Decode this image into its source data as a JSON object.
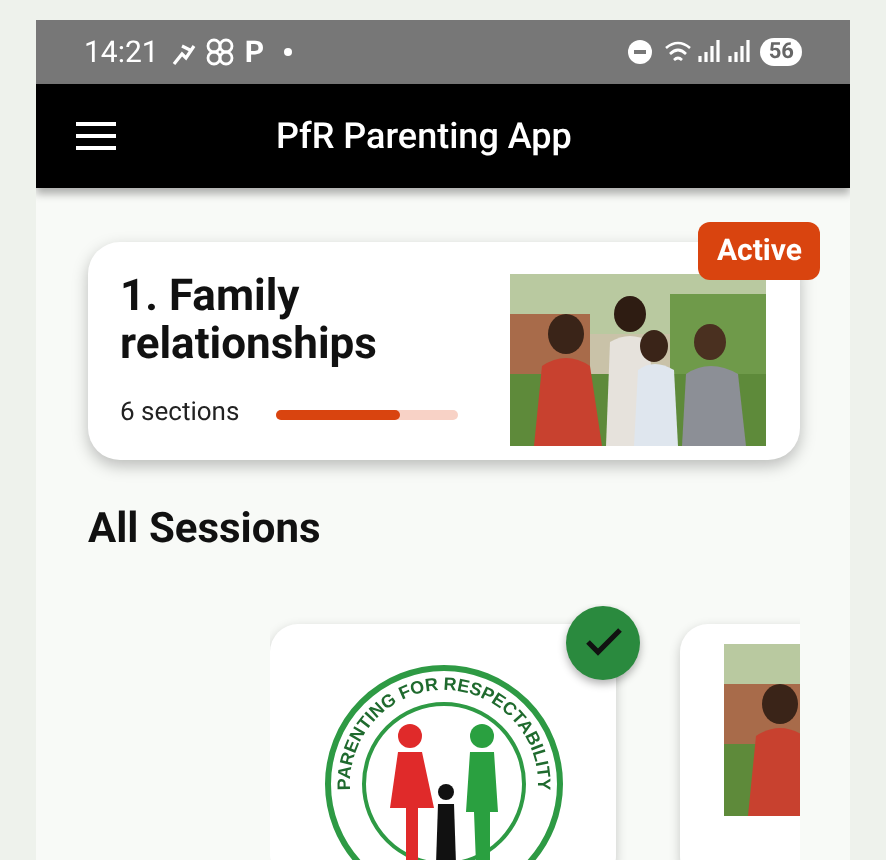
{
  "status_bar": {
    "time": "14:21",
    "notification_letter": "P",
    "battery": "56"
  },
  "app_bar": {
    "title": "PfR Parenting App"
  },
  "active_session": {
    "title": "1. Family relationships",
    "badge": "Active",
    "sections": "6 sections",
    "level": 0.68
  },
  "all_sessions": {
    "heading": "All Sessions",
    "sessions": [
      {
        "kind": "logo",
        "logo_text": "PARENTING FOR RESPECTABILITY",
        "completed": true
      },
      {
        "kind": "picture",
        "completed": false
      }
    ]
  }
}
